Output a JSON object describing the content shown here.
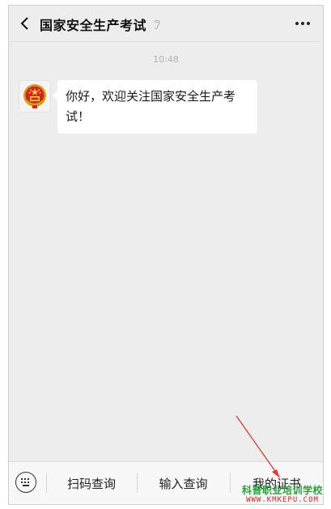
{
  "header": {
    "title": "国家安全生产考试",
    "back_icon": "chevron-left-icon",
    "ear_icon": "ear-icon",
    "more_icon": "more-dots-icon"
  },
  "chat": {
    "timestamp": "10:48",
    "messages": [
      {
        "sender_icon": "national-emblem-avatar",
        "text": "你好，欢迎关注国家安全生产考试！"
      }
    ]
  },
  "menu": {
    "keyboard_icon": "keyboard-icon",
    "items": [
      {
        "label": "扫码查询"
      },
      {
        "label": "输入查询"
      },
      {
        "label": "我的证书"
      }
    ]
  },
  "watermark": {
    "main": "科普职业培训学校",
    "sub": "WWW.KMKEPU.COM"
  },
  "colors": {
    "background": "#ededed",
    "bubble": "#ffffff",
    "watermark_green": "#2aa33a",
    "watermark_red": "#e02020",
    "arrow": "#e53935"
  }
}
